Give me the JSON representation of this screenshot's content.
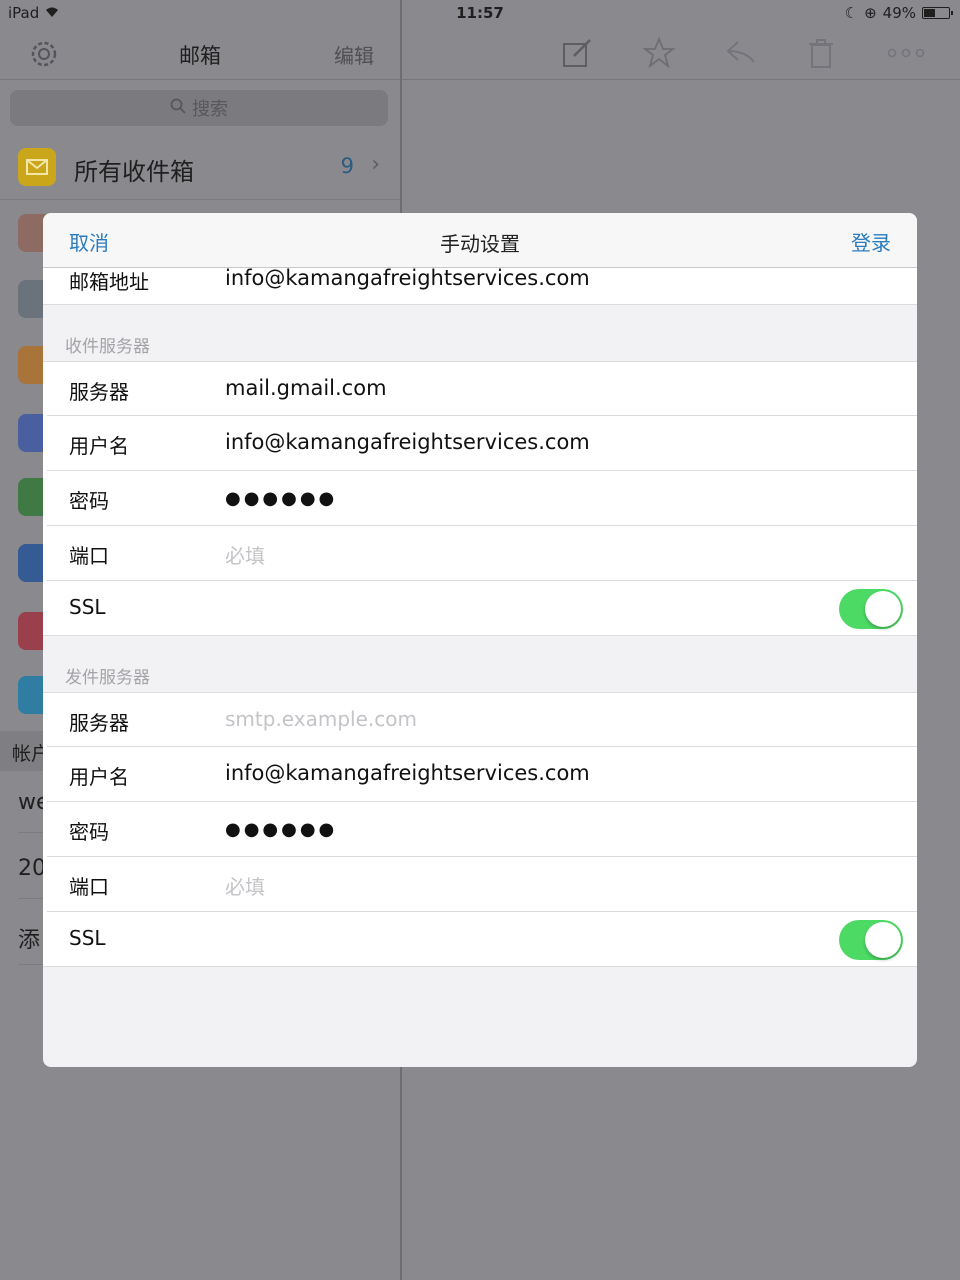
{
  "status": {
    "device": "iPad",
    "time": "11:57",
    "battery": "49%",
    "battery_level": 0.49
  },
  "sidebar": {
    "title": "邮箱",
    "edit_label": "编辑",
    "search_placeholder": "搜索",
    "inbox": {
      "label": "所有收件箱",
      "count": "9"
    },
    "accounts_header": "帐户",
    "account_rows": [
      "we",
      "20",
      "添"
    ]
  },
  "modal": {
    "cancel": "取消",
    "title": "手动设置",
    "login": "登录",
    "email_row": {
      "label": "邮箱地址",
      "value": "info@kamangafreightservices.com"
    },
    "incoming": {
      "section": "收件服务器",
      "server": {
        "label": "服务器",
        "value": "mail.gmail.com"
      },
      "username": {
        "label": "用户名",
        "value": "info@kamangafreightservices.com"
      },
      "password": {
        "label": "密码",
        "value": "●●●●●●"
      },
      "port": {
        "label": "端口",
        "placeholder": "必填"
      },
      "ssl": {
        "label": "SSL",
        "on": true
      }
    },
    "outgoing": {
      "section": "发件服务器",
      "server": {
        "label": "服务器",
        "placeholder": "smtp.example.com"
      },
      "username": {
        "label": "用户名",
        "value": "info@kamangafreightservices.com"
      },
      "password": {
        "label": "密码",
        "value": "●●●●●●"
      },
      "port": {
        "label": "端口",
        "placeholder": "必填"
      },
      "ssl": {
        "label": "SSL",
        "on": true
      }
    }
  },
  "colors": {
    "accent": "#2b7bbd",
    "toggle_on": "#4cd964",
    "inbox_icon": "#c9a61a"
  }
}
